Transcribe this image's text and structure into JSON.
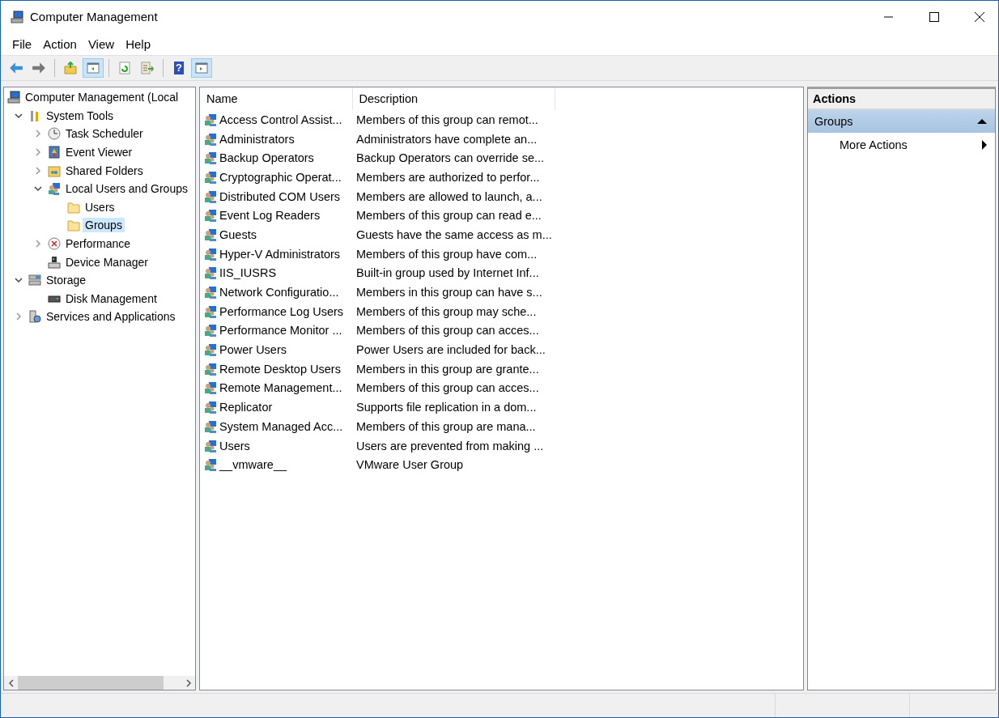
{
  "window": {
    "title": "Computer Management"
  },
  "menu": [
    "File",
    "Action",
    "View",
    "Help"
  ],
  "toolbar": [
    {
      "kind": "back",
      "pressed": false
    },
    {
      "kind": "forward",
      "pressed": false
    },
    {
      "kind": "sep"
    },
    {
      "kind": "up",
      "pressed": false
    },
    {
      "kind": "tree",
      "pressed": true
    },
    {
      "kind": "sep"
    },
    {
      "kind": "refresh",
      "pressed": false
    },
    {
      "kind": "export",
      "pressed": false
    },
    {
      "kind": "sep"
    },
    {
      "kind": "help",
      "pressed": false,
      "glyph": "?"
    },
    {
      "kind": "actionpane",
      "pressed": true
    }
  ],
  "tree": [
    {
      "label": "Computer Management (Local",
      "kind": "computer",
      "selected": false,
      "children": [
        {
          "label": "System Tools",
          "kind": "tools",
          "expanded": true,
          "selected": false,
          "children": [
            {
              "label": "Task Scheduler",
              "kind": "clock",
              "expanded": false,
              "selected": false
            },
            {
              "label": "Event Viewer",
              "kind": "event",
              "expanded": false,
              "selected": false
            },
            {
              "label": "Shared Folders",
              "kind": "share",
              "expanded": false,
              "selected": false
            },
            {
              "label": "Local Users and Groups",
              "kind": "users",
              "expanded": true,
              "selected": false,
              "children": [
                {
                  "label": "Users",
                  "kind": "folder",
                  "selected": false
                },
                {
                  "label": "Groups",
                  "kind": "folder",
                  "selected": true
                }
              ]
            },
            {
              "label": "Performance",
              "kind": "perf",
              "expanded": false,
              "selected": false
            },
            {
              "label": "Device Manager",
              "kind": "device",
              "selected": false
            }
          ]
        },
        {
          "label": "Storage",
          "kind": "storage",
          "expanded": true,
          "selected": false,
          "children": [
            {
              "label": "Disk Management",
              "kind": "disk",
              "selected": false
            }
          ]
        },
        {
          "label": "Services and Applications",
          "kind": "services",
          "expanded": false,
          "selected": false
        }
      ]
    }
  ],
  "table": {
    "columns": [
      "Name",
      "Description"
    ],
    "rows": [
      [
        "Access Control Assist...",
        "Members of this group can remot..."
      ],
      [
        "Administrators",
        "Administrators have complete an..."
      ],
      [
        "Backup Operators",
        "Backup Operators can override se..."
      ],
      [
        "Cryptographic Operat...",
        "Members are authorized to perfor..."
      ],
      [
        "Distributed COM Users",
        "Members are allowed to launch, a..."
      ],
      [
        "Event Log Readers",
        "Members of this group can read e..."
      ],
      [
        "Guests",
        "Guests have the same access as m..."
      ],
      [
        "Hyper-V Administrators",
        "Members of this group have com..."
      ],
      [
        "IIS_IUSRS",
        "Built-in group used by Internet Inf..."
      ],
      [
        "Network Configuratio...",
        "Members in this group can have s..."
      ],
      [
        "Performance Log Users",
        "Members of this group may sche..."
      ],
      [
        "Performance Monitor ...",
        "Members of this group can acces..."
      ],
      [
        "Power Users",
        "Power Users are included for back..."
      ],
      [
        "Remote Desktop Users",
        "Members in this group are grante..."
      ],
      [
        "Remote Management...",
        "Members of this group can acces..."
      ],
      [
        "Replicator",
        "Supports file replication in a dom..."
      ],
      [
        "System Managed Acc...",
        "Members of this group are mana..."
      ],
      [
        "Users",
        "Users are prevented from making ..."
      ],
      [
        "__vmware__",
        "VMware User Group"
      ]
    ]
  },
  "actions": {
    "title": "Actions",
    "sections": [
      {
        "title": "Groups",
        "expanded": true,
        "items": [
          "More Actions"
        ]
      }
    ]
  }
}
